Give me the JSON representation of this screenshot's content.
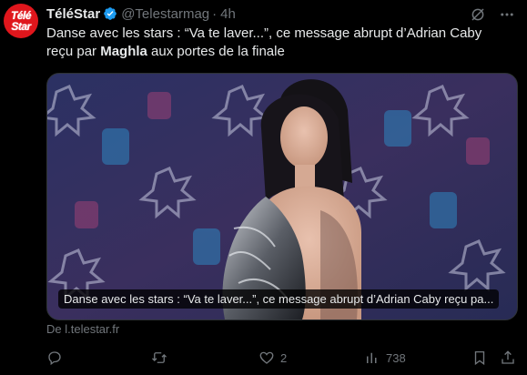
{
  "account": {
    "name": "TéléStar",
    "handle": "@Telestarmag",
    "separator": "·",
    "time": "4h",
    "avatar_line1": "Télé",
    "avatar_line2": "Star"
  },
  "tweet": {
    "text_part1": "Danse avec les stars : “Va te laver...”, ce message abrupt d’Adrian Caby reçu par ",
    "text_bold": "Maghla",
    "text_part2": " aux portes de la finale"
  },
  "card": {
    "caption": "Danse avec les stars : “Va te laver...”, ce message abrupt d’Adrian Caby reçu pa...",
    "source": "De l.telestar.fr"
  },
  "actions": {
    "reply_count": "",
    "retweet_count": "",
    "like_count": "2",
    "views_count": "738"
  },
  "icons": {
    "verified": "verified-badge-icon",
    "grok": "grok-icon",
    "more": "more-icon",
    "reply": "reply-icon",
    "retweet": "retweet-icon",
    "like": "heart-icon",
    "views": "views-icon",
    "bookmark": "bookmark-icon",
    "share": "share-icon"
  },
  "colors": {
    "background": "#000000",
    "text": "#e7e9ea",
    "muted": "#71767b",
    "verified": "#1d9bf0",
    "brand": "#e0161c"
  }
}
